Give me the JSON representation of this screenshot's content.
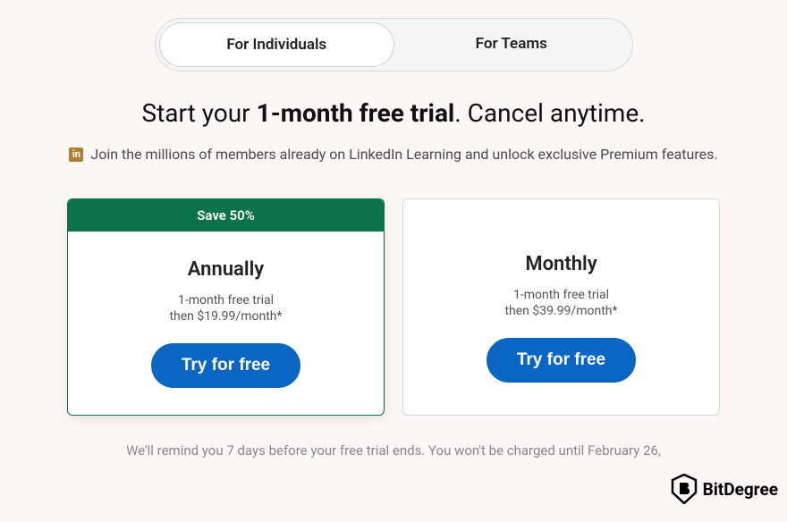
{
  "tabs": {
    "individuals": "For Individuals",
    "teams": "For Teams"
  },
  "headline": {
    "prefix": "Start your ",
    "bold": "1-month free trial",
    "suffix": ". Cancel anytime."
  },
  "subline": {
    "icon_label": "in",
    "text": "Join the millions of members already on LinkedIn Learning and unlock exclusive Premium features."
  },
  "plans": {
    "annually": {
      "save_banner": "Save 50%",
      "name": "Annually",
      "trial": "1-month free trial",
      "price": "then $19.99/month*",
      "cta": "Try for free"
    },
    "monthly": {
      "name": "Monthly",
      "trial": "1-month free trial",
      "price": "then $39.99/month*",
      "cta": "Try for free"
    }
  },
  "footer_note": "We'll remind you 7 days before your free trial ends. You won't be charged until February 26,",
  "watermark": "BitDegree",
  "colors": {
    "save_banner_bg": "#0b7347",
    "cta_bg": "#0a66c2",
    "page_bg": "#fcf7f4"
  }
}
